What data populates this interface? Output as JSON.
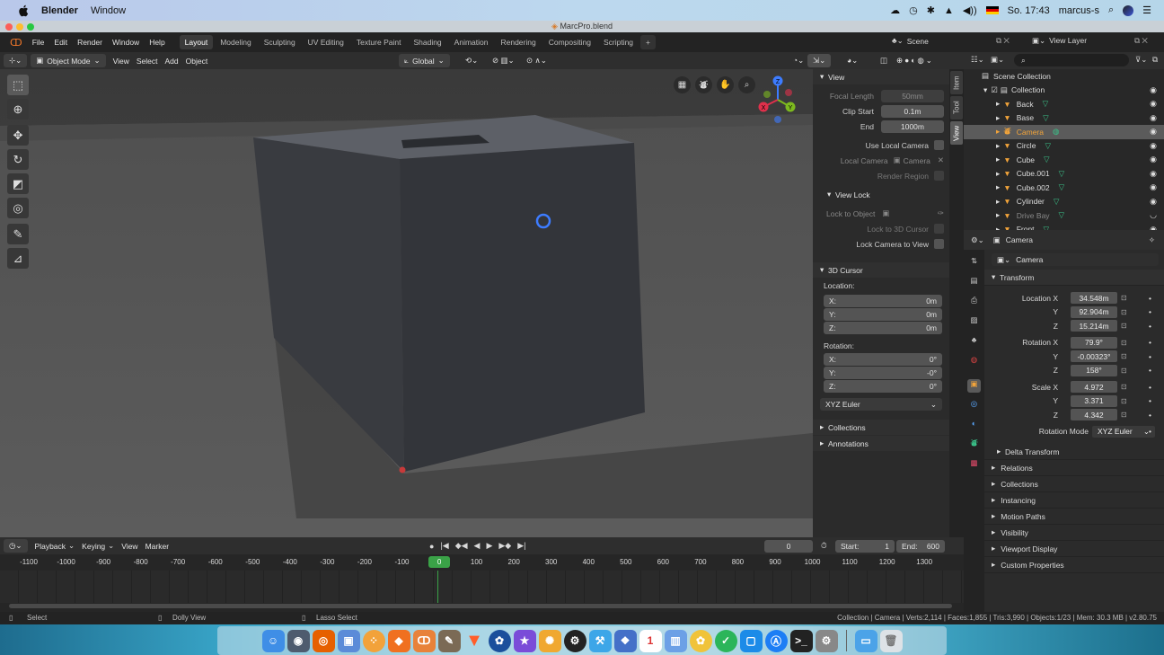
{
  "menubar": {
    "app": "Blender",
    "menu": "Window",
    "clock": "So. 17:43",
    "user": "marcus-s"
  },
  "window": {
    "title": "MarcPro.blend"
  },
  "topbar": {
    "menus": [
      "File",
      "Edit",
      "Render",
      "Window",
      "Help"
    ],
    "workspaces": [
      "Layout",
      "Modeling",
      "Sculpting",
      "UV Editing",
      "Texture Paint",
      "Shading",
      "Animation",
      "Rendering",
      "Compositing",
      "Scripting"
    ],
    "active_workspace": "Layout",
    "scene": "Scene",
    "view_layer": "View Layer"
  },
  "viewport_header": {
    "mode": "Object Mode",
    "menus": [
      "View",
      "Select",
      "Add",
      "Object"
    ],
    "orientation": "Global"
  },
  "npanel": {
    "tabs": [
      "Item",
      "Tool",
      "View"
    ],
    "view": {
      "title": "View",
      "focal_length_label": "Focal Length",
      "focal_length": "50mm",
      "clip_start_label": "Clip Start",
      "clip_start": "0.1m",
      "end_label": "End",
      "end": "1000m",
      "use_local_camera": "Use Local Camera",
      "local_camera_label": "Local Camera",
      "local_camera": "Camera",
      "render_region": "Render Region"
    },
    "view_lock": {
      "title": "View Lock",
      "lock_to_object": "Lock to Object",
      "lock_to_3d_cursor": "Lock to 3D Cursor",
      "lock_camera_to_view": "Lock Camera to View"
    },
    "cursor": {
      "title": "3D Cursor",
      "location_label": "Location:",
      "x_label": "X:",
      "x": "0m",
      "y_label": "Y:",
      "y": "0m",
      "z_label": "Z:",
      "z": "0m",
      "rotation_label": "Rotation:",
      "rx_label": "X:",
      "rx": "0°",
      "ry_label": "Y:",
      "ry": "-0°",
      "rz_label": "Z:",
      "rz": "0°",
      "rotation_mode": "XYZ Euler"
    },
    "collections": "Collections",
    "annotations": "Annotations"
  },
  "timeline": {
    "menus": [
      "Playback",
      "Keying",
      "View",
      "Marker"
    ],
    "current_frame": "0",
    "start_label": "Start:",
    "start": "1",
    "end_label": "End:",
    "end": "600",
    "ruler": [
      "-1100",
      "-1000",
      "-900",
      "-800",
      "-700",
      "-600",
      "-500",
      "-400",
      "-300",
      "-200",
      "-100",
      "0",
      "100",
      "200",
      "300",
      "400",
      "500",
      "600",
      "700",
      "800",
      "900",
      "1000",
      "1100",
      "1200",
      "1300"
    ],
    "playhead": "0"
  },
  "statusbar": {
    "select": "Select",
    "dolly": "Dolly View",
    "lasso": "Lasso Select",
    "stats": "Collection | Camera | Verts:2,114 | Faces:1,855 | Tris:3,990 | Objects:1/23 | Mem: 30.3 MB | v2.80.75"
  },
  "outliner": {
    "root": "Scene Collection",
    "collection": "Collection",
    "items": [
      {
        "name": "Back",
        "selected": false,
        "dim": false
      },
      {
        "name": "Base",
        "selected": false,
        "dim": false
      },
      {
        "name": "Camera",
        "selected": true,
        "dim": false
      },
      {
        "name": "Circle",
        "selected": false,
        "dim": false
      },
      {
        "name": "Cube",
        "selected": false,
        "dim": false
      },
      {
        "name": "Cube.001",
        "selected": false,
        "dim": false
      },
      {
        "name": "Cube.002",
        "selected": false,
        "dim": false
      },
      {
        "name": "Cylinder",
        "selected": false,
        "dim": false
      },
      {
        "name": "Drive Bay",
        "selected": false,
        "dim": true
      },
      {
        "name": "Front",
        "selected": false,
        "dim": false
      }
    ]
  },
  "properties": {
    "object": "Camera",
    "datablock": "Camera",
    "transform_title": "Transform",
    "rows": [
      {
        "label": "Location X",
        "value": "34.548m"
      },
      {
        "label": "Y",
        "value": "92.904m"
      },
      {
        "label": "Z",
        "value": "15.214m"
      },
      {
        "label": "Rotation X",
        "value": "79.9°"
      },
      {
        "label": "Y",
        "value": "-0.00323°"
      },
      {
        "label": "Z",
        "value": "158°"
      },
      {
        "label": "Scale X",
        "value": "4.972"
      },
      {
        "label": "Y",
        "value": "3.371"
      },
      {
        "label": "Z",
        "value": "4.342"
      }
    ],
    "rotation_mode_label": "Rotation Mode",
    "rotation_mode": "XYZ Euler",
    "delta_transform": "Delta Transform",
    "sections": [
      "Relations",
      "Collections",
      "Instancing",
      "Motion Paths",
      "Visibility",
      "Viewport Display",
      "Custom Properties"
    ]
  },
  "colors": {
    "accent": "#4772b3",
    "selection_orange": "#f2a43a",
    "object_green": "#00d49a"
  }
}
